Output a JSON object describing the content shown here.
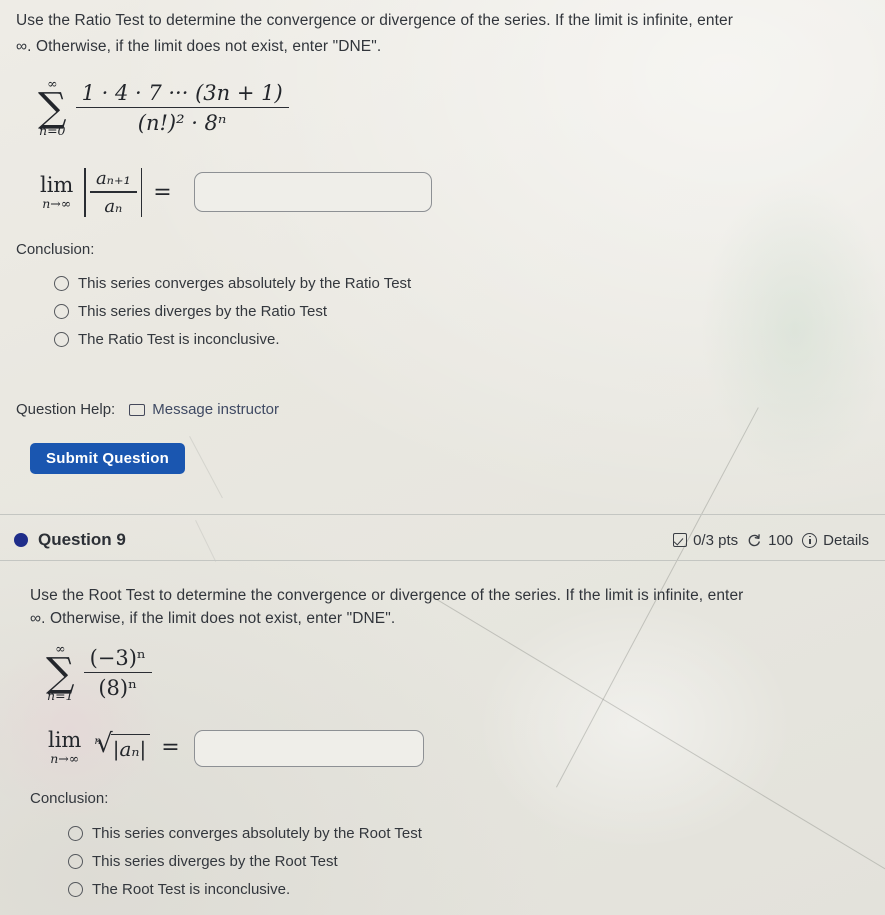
{
  "question8": {
    "prompt_line1": "Use the Ratio Test to determine the convergence or divergence of the series. If the limit is infinite, enter",
    "prompt_line2": "∞. Otherwise, if the limit does not exist, enter \"DNE\".",
    "series": {
      "sigma_upper": "∞",
      "sigma_lower": "n=0",
      "numerator": "1 · 4 · 7 ··· (3n + 1)",
      "denominator": "(n!)² · 8ⁿ"
    },
    "limit_expression": {
      "lim": "lim",
      "lim_sub": "n→∞",
      "ratio_numerator": "aₙ₊₁",
      "ratio_denominator": "aₙ",
      "equals": "="
    },
    "answer_value": "",
    "answer_placeholder": "",
    "conclusion_label": "Conclusion:",
    "options": [
      "This series converges absolutely by the Ratio Test",
      "This series diverges by the Ratio Test",
      "The Ratio Test is inconclusive."
    ],
    "help_label": "Question Help:",
    "message_instructor": "Message instructor",
    "submit_label": "Submit Question"
  },
  "question9": {
    "header": {
      "dot_color": "#1f2d8a",
      "title": "Question 9",
      "points": "0/3 pts",
      "attempts": "100",
      "details": "Details"
    },
    "prompt_line1": "Use the Root Test to determine the convergence or divergence of the series. If the limit is infinite, enter",
    "prompt_line2": "∞. Otherwise, if the limit does not exist, enter \"DNE\".",
    "series": {
      "sigma_upper": "∞",
      "sigma_lower": "n=1",
      "numerator": "(−3)ⁿ",
      "denominator": "(8)ⁿ"
    },
    "limit_expression": {
      "lim": "lim",
      "lim_sub": "n→∞",
      "root_index": "n",
      "radicand": "|aₙ|",
      "equals": "="
    },
    "answer_value": "",
    "answer_placeholder": "",
    "conclusion_label": "Conclusion:",
    "options": [
      "This series converges absolutely by the Root Test",
      "This series diverges by the Root Test",
      "The Root Test is inconclusive."
    ]
  },
  "theme": {
    "page_background": "#eceae4",
    "text_color": "#33373d",
    "submit_blue": "#1a56b0",
    "link_color": "#3f4a63",
    "rule_color": "#c4c6c2",
    "input_border": "#8d9094"
  }
}
